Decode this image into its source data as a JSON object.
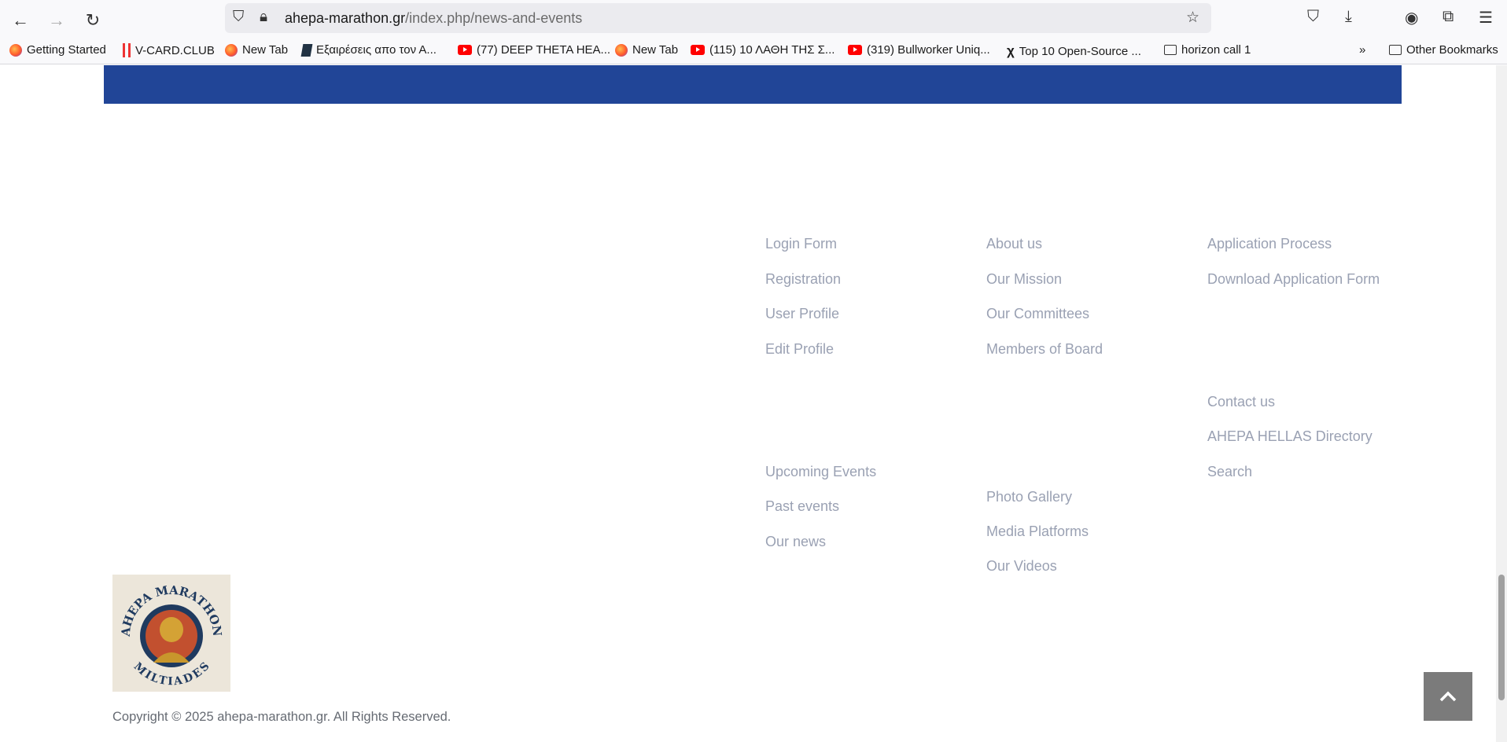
{
  "browser": {
    "url_domain": "ahepa-marathon.gr",
    "url_path": "/index.php/news-and-events",
    "bookmarks": [
      {
        "label": "Getting Started",
        "icon": "firefox-icon"
      },
      {
        "label": "V-CARD.CLUB",
        "icon": "vcard-icon"
      },
      {
        "label": "New Tab",
        "icon": "firefox-icon"
      },
      {
        "label": "Εξαιρέσεις απο τον Α...",
        "icon": "document-icon"
      },
      {
        "label": "(77) DEEP THETA HEA...",
        "icon": "youtube-icon"
      },
      {
        "label": "New Tab",
        "icon": "firefox-icon"
      },
      {
        "label": "(115) 10 ΛΑΘΗ ΤΗΣ Σ...",
        "icon": "youtube-icon"
      },
      {
        "label": "(319) Bullworker Uniq...",
        "icon": "youtube-icon"
      },
      {
        "label": "Top 10 Open-Source ...",
        "icon": "x-icon"
      },
      {
        "label": "horizon call 1",
        "icon": "folder-icon"
      }
    ],
    "other_bookmarks": "Other Bookmarks"
  },
  "footer": {
    "col1": [
      "Login Form",
      "Registration",
      "User Profile",
      "Edit Profile",
      "Upcoming Events",
      "Past events",
      "Our news"
    ],
    "col2": [
      "About us",
      "Our Mission",
      "Our Committees",
      "Members of Board",
      "Photo Gallery",
      "Media Platforms",
      "Our Videos"
    ],
    "col3": [
      "Application Process",
      "Download Application Form",
      "Contact us",
      "AHEPA HELLAS Directory",
      "Search"
    ],
    "logo_text_top": "AHEPA MARATHON",
    "logo_text_bottom": "MILTIADES",
    "copyright": "Copyright © 2025 ahepa-marathon.gr. All Rights Reserved."
  }
}
